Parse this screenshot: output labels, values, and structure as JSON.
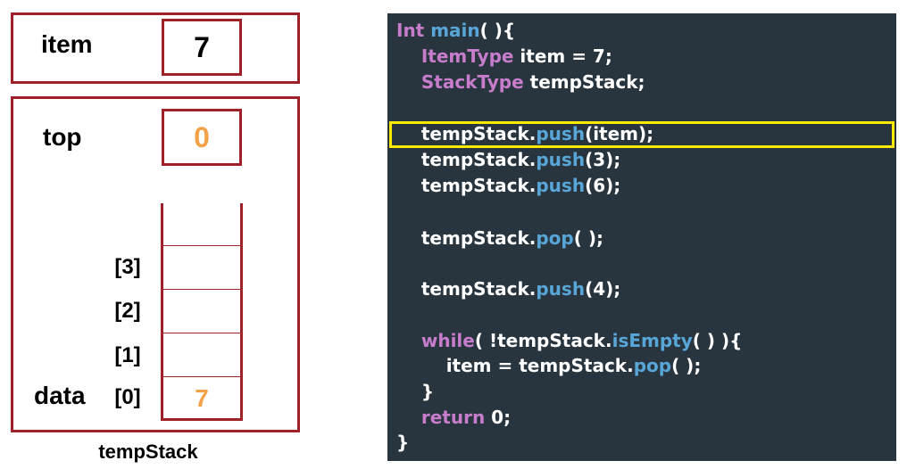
{
  "item": {
    "label": "item",
    "value": "7"
  },
  "stack": {
    "top_label": "top",
    "top_value": "0",
    "data_label": "data",
    "indices": [
      "[3]",
      "[2]",
      "[1]",
      "[0]"
    ],
    "cells": [
      "",
      "",
      "",
      "7"
    ],
    "caption": "tempStack"
  },
  "code": {
    "lines": [
      [
        {
          "t": "Int ",
          "c": "kw"
        },
        {
          "t": "main",
          "c": "fn"
        },
        {
          "t": "( ){",
          "c": ""
        }
      ],
      [
        {
          "t": "    ",
          "c": ""
        },
        {
          "t": "ItemType",
          "c": "kw"
        },
        {
          "t": " item = 7;",
          "c": ""
        }
      ],
      [
        {
          "t": "    ",
          "c": ""
        },
        {
          "t": "StackType",
          "c": "kw"
        },
        {
          "t": " tempStack;",
          "c": ""
        }
      ],
      [],
      [
        {
          "t": "    tempStack.",
          "c": ""
        },
        {
          "t": "push",
          "c": "fn"
        },
        {
          "t": "(item);",
          "c": ""
        }
      ],
      [
        {
          "t": "    tempStack.",
          "c": ""
        },
        {
          "t": "push",
          "c": "fn"
        },
        {
          "t": "(3);",
          "c": ""
        }
      ],
      [
        {
          "t": "    tempStack.",
          "c": ""
        },
        {
          "t": "push",
          "c": "fn"
        },
        {
          "t": "(6);",
          "c": ""
        }
      ],
      [],
      [
        {
          "t": "    tempStack.",
          "c": ""
        },
        {
          "t": "pop",
          "c": "fn"
        },
        {
          "t": "( );",
          "c": ""
        }
      ],
      [],
      [
        {
          "t": "    tempStack.",
          "c": ""
        },
        {
          "t": "push",
          "c": "fn"
        },
        {
          "t": "(4);",
          "c": ""
        }
      ],
      [],
      [
        {
          "t": "    ",
          "c": ""
        },
        {
          "t": "while",
          "c": "kw"
        },
        {
          "t": "( !tempStack.",
          "c": ""
        },
        {
          "t": "isEmpty",
          "c": "fn"
        },
        {
          "t": "( ) ){",
          "c": ""
        }
      ],
      [
        {
          "t": "        item = tempStack.",
          "c": ""
        },
        {
          "t": "pop",
          "c": "fn"
        },
        {
          "t": "( );",
          "c": ""
        }
      ],
      [
        {
          "t": "    }",
          "c": ""
        }
      ],
      [
        {
          "t": "    ",
          "c": ""
        },
        {
          "t": "return",
          "c": "kw"
        },
        {
          "t": " 0;",
          "c": ""
        }
      ],
      [
        {
          "t": "}",
          "c": ""
        }
      ]
    ],
    "highlighted_line": 4
  },
  "colors": {
    "border": "#9e2028",
    "value_orange": "#f3a24a",
    "panel_bg": "#28353f",
    "keyword": "#c77dcc",
    "function": "#58a6d8",
    "highlight": "#ffea00"
  }
}
